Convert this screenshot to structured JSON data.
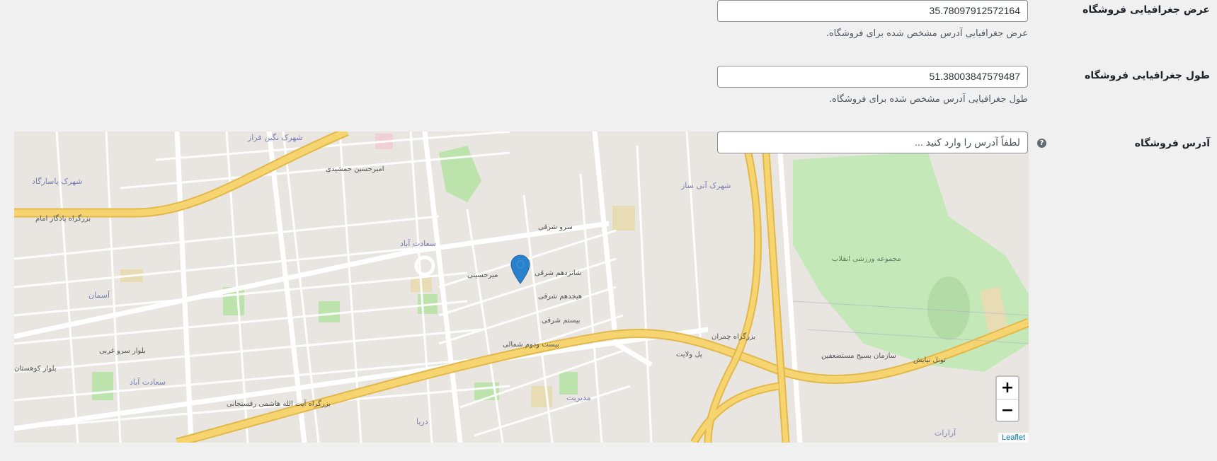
{
  "fields": {
    "latitude": {
      "label": "عرض جغرافیایی فروشگاه",
      "value": "35.78097912572164",
      "description": "عرض جغرافیایی آدرس مشخص شده برای فروشگاه."
    },
    "longitude": {
      "label": "طول جغرافیایی فروشگاه",
      "value": "51.38003847579487",
      "description": "طول جغرافیایی آدرس مشخص شده برای فروشگاه."
    },
    "address": {
      "label": "آدرس فروشگاه",
      "placeholder": "لطفاً آدرس را وارد کنید ...",
      "help_icon": "question-circle-icon"
    }
  },
  "map": {
    "zoom_in": "+",
    "zoom_out": "−",
    "attribution": "Leaflet",
    "marker_icon": "map-pin-icon",
    "marker_color": "#2a81cb",
    "labels": {
      "l1": "شهرک نگین فراز",
      "l2": "شهرک پاسارگاد",
      "l3": "بزرگراه یادگار امام",
      "l4": "سعادت آباد",
      "l5": "آسمان",
      "l6": "بلوار سرو غربی",
      "l7": "میرحسینی",
      "l8": "شانزدهم شرقی",
      "l9": "هیجدهم شرقی",
      "l10": "بیستم شرقی",
      "l11": "بیست ودوم شمالی",
      "l12": "مدیریت",
      "l13": "دریا",
      "l14": "بزرگراه آیت الله هاشمی رفسنجانی",
      "l15": "شهرک آتی ساز",
      "l16": "مجموعه ورزشی انقلاب",
      "l17": "سازمان بسیج مستضعفین",
      "l18": "تونل نیایش",
      "l19": "آرارات",
      "l20": "سرو شرقی",
      "l21": "بزرگراه چمران",
      "l22": "پل ولایت",
      "l23": "سعادت آباد",
      "l24": "بلوار کوهستان",
      "l25": "امیرحسین جمشیدی"
    }
  }
}
